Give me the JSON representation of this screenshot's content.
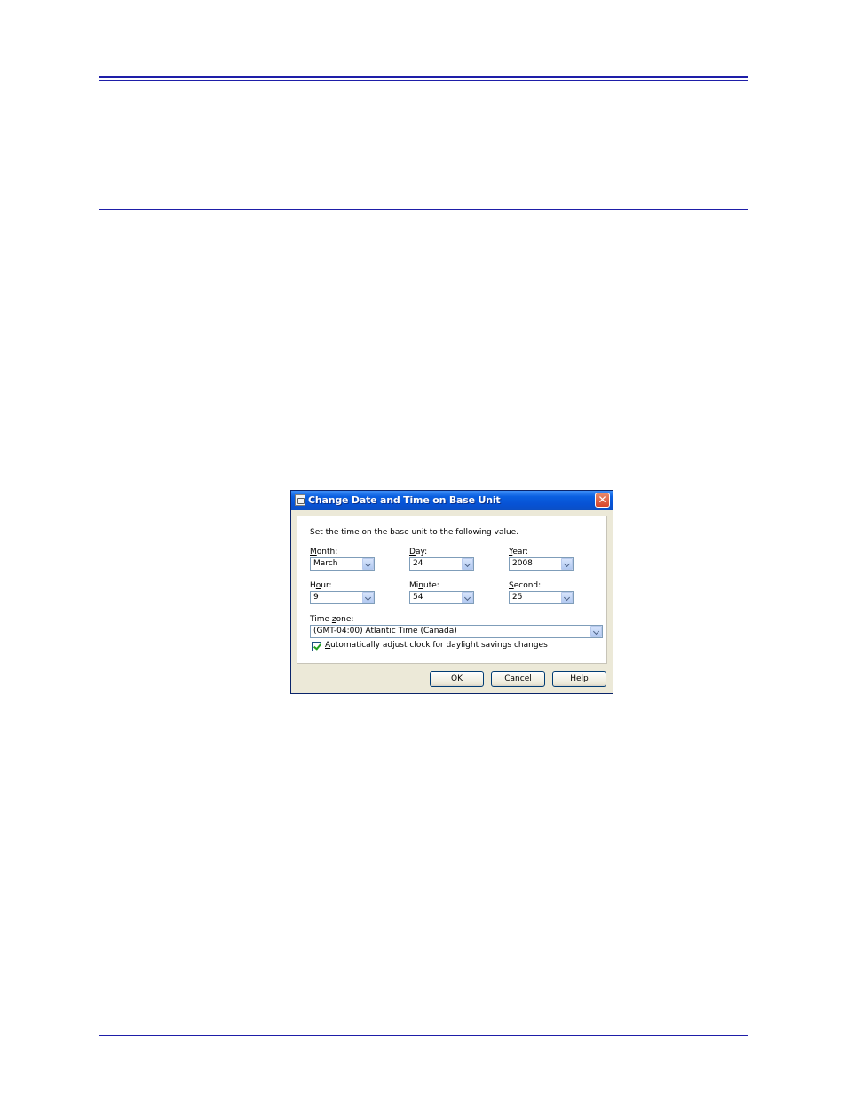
{
  "dialog": {
    "title": "Change Date and Time on Base Unit",
    "instruction": "Set the time on the base unit to the following value.",
    "fields": {
      "month": {
        "label_key": "M",
        "label_rest": "onth:",
        "value": "March"
      },
      "day": {
        "label_key": "D",
        "label_rest": "ay:",
        "value": "24"
      },
      "year": {
        "label_key": "Y",
        "label_rest": "ear:",
        "value": "2008"
      },
      "hour": {
        "label_pre": "H",
        "label_key": "o",
        "label_rest": "ur:",
        "value": "9"
      },
      "minute": {
        "label_pre": "Mi",
        "label_key": "n",
        "label_rest": "ute:",
        "value": "54"
      },
      "second": {
        "label_key": "S",
        "label_rest": "econd:",
        "value": "25"
      }
    },
    "timezone": {
      "label_pre": "Time ",
      "label_key": "z",
      "label_rest": "one:",
      "value": "(GMT-04:00) Atlantic Time (Canada)"
    },
    "dst": {
      "label_key": "A",
      "label_rest": "utomatically adjust clock for daylight savings changes",
      "checked": true
    },
    "buttons": {
      "ok": "OK",
      "cancel": "Cancel",
      "help_key": "H",
      "help_rest": "elp"
    }
  }
}
